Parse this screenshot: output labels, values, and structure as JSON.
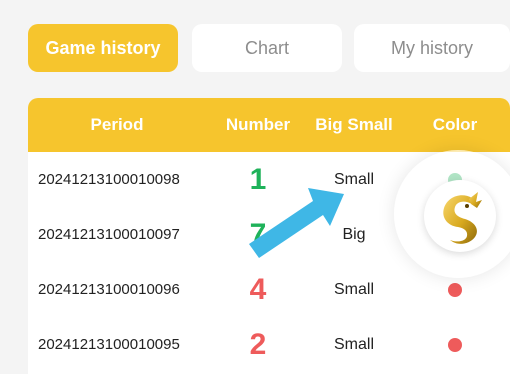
{
  "tabs": [
    {
      "label": "Game history",
      "active": true
    },
    {
      "label": "Chart",
      "active": false
    },
    {
      "label": "My history",
      "active": false
    }
  ],
  "table": {
    "headers": {
      "period": "Period",
      "number": "Number",
      "big_small": "Big Small",
      "color": "Color"
    },
    "rows": [
      {
        "period": "20241213100010098",
        "number": "1",
        "number_color": "#1fb25a",
        "big_small": "Small",
        "dot_color": "#1fb25a"
      },
      {
        "period": "20241213100010097",
        "number": "7",
        "number_color": "#1fb25a",
        "big_small": "Big",
        "dot_color": "#1fb25a"
      },
      {
        "period": "20241213100010096",
        "number": "4",
        "number_color": "#ee5b5b",
        "big_small": "Small",
        "dot_color": "#ee5b5b"
      },
      {
        "period": "20241213100010095",
        "number": "2",
        "number_color": "#ee5b5b",
        "big_small": "Small",
        "dot_color": "#ee5b5b"
      }
    ]
  },
  "colors": {
    "accent": "#f6c52d",
    "green": "#1fb25a",
    "red": "#ee5b5b",
    "arrow": "#3fb7e6"
  },
  "icons": {
    "pointer_arrow": "arrow-icon",
    "dragon_logo": "dragon-logo-icon"
  }
}
